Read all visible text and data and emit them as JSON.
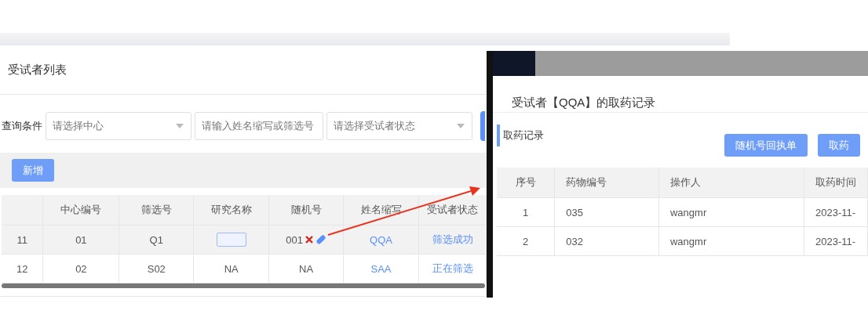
{
  "list_panel": {
    "title": "受试者列表",
    "query": {
      "label": "查询条件",
      "center_select": {
        "placeholder": "请选择中心"
      },
      "search": {
        "placeholder": "请输入姓名缩写或筛选号"
      },
      "status_select": {
        "placeholder": "请选择受试者状态"
      }
    },
    "add_button": "新增",
    "table": {
      "columns": [
        "",
        "中心编号",
        "筛选号",
        "研究名称",
        "随机号",
        "姓名缩写",
        "受试者状态"
      ],
      "rows": [
        {
          "index": "11",
          "center": "01",
          "screen_no": "Q1",
          "study": {
            "kind": "redacted"
          },
          "random_no": "001",
          "random_actions": true,
          "initials": "QQA",
          "status": "筛选成功",
          "highlighted": true
        },
        {
          "index": "12",
          "center": "02",
          "screen_no": "S02",
          "study": {
            "kind": "text",
            "text": "NA"
          },
          "random_no": "NA",
          "random_actions": false,
          "initials": "SAA",
          "status": "正在筛选",
          "highlighted": false
        }
      ]
    }
  },
  "dialog": {
    "title": "受试者【QQA】的取药记录",
    "section": "取药记录",
    "buttons": [
      "随机号回执单",
      "取药"
    ],
    "table": {
      "columns": [
        "序号",
        "药物编号",
        "操作人",
        "取药时间"
      ],
      "rows": [
        {
          "no": "1",
          "drug": "035",
          "operator": "wangmr",
          "time": "2023-11-"
        },
        {
          "no": "2",
          "drug": "032",
          "operator": "wangmr",
          "time": "2023-11-"
        }
      ]
    }
  }
}
